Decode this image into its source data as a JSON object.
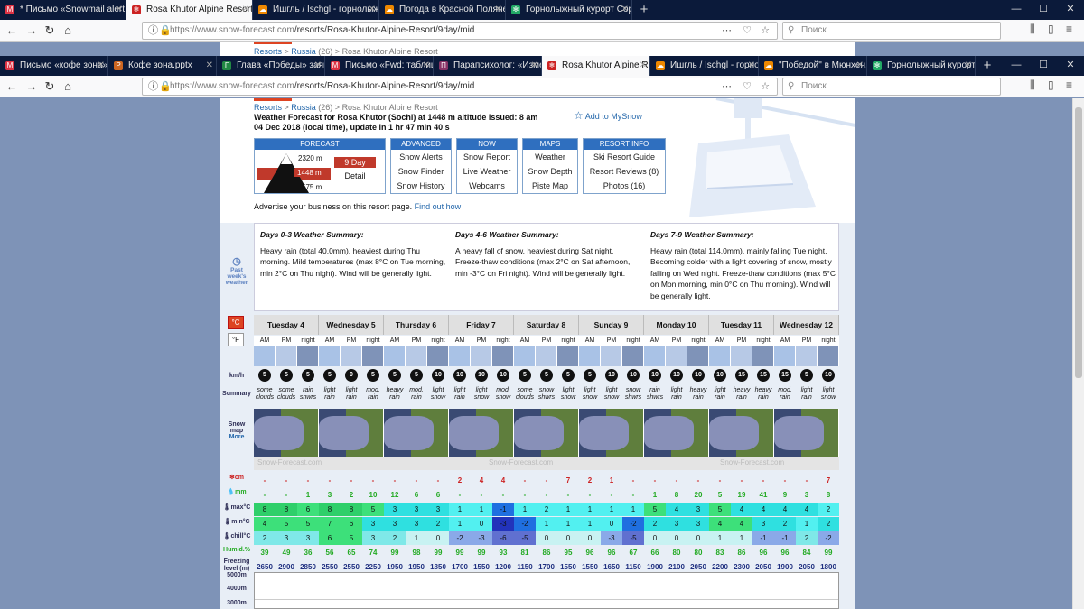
{
  "browser_back": {
    "tabs": [
      {
        "label": "* Письмо «Snowmail alert for R",
        "color": "#d34",
        "glyph": "M"
      },
      {
        "label": "Rosa Khutor Alpine Resort 9 Da",
        "color": "#c22",
        "glyph": "❄",
        "active": true
      },
      {
        "label": "Ишгль / Ischgl - горнолыжн",
        "color": "#e80",
        "glyph": "☁"
      },
      {
        "label": "Погода в Красной Поляне - С",
        "color": "#e80",
        "glyph": "☁"
      },
      {
        "label": "Горнолыжный курорт Сорон",
        "color": "#2a6",
        "glyph": "✻"
      }
    ],
    "url_domain": "https://www.snow-forecast.com",
    "url_path": "/resorts/Rosa-Khutor-Alpine-Resort/9day/mid",
    "search_placeholder": "Поиск"
  },
  "browser_front": {
    "tabs": [
      {
        "label": "Письмо «кофе зона»",
        "color": "#d34",
        "glyph": "M"
      },
      {
        "label": "Кофе зона.pptx",
        "color": "#c62",
        "glyph": "P"
      },
      {
        "label": "Глава «Победы» заявил",
        "color": "#284",
        "glyph": "Г"
      },
      {
        "label": "Письмо «Fwd: таблиц",
        "color": "#d34",
        "glyph": "M"
      },
      {
        "label": "Парапсихолог: «Измен",
        "color": "#836",
        "glyph": "П"
      },
      {
        "label": "Rosa Khutor Alpine Resor",
        "color": "#c22",
        "glyph": "❄",
        "active": true
      },
      {
        "label": "Ишгль / Ischgl - горнол",
        "color": "#e80",
        "glyph": "☁"
      },
      {
        "label": "\"Победой\" в Мюнхен. ",
        "color": "#e80",
        "glyph": "☁"
      },
      {
        "label": "Горнолыжный курорт С",
        "color": "#2a6",
        "glyph": "✻"
      }
    ],
    "url_domain": "https://www.snow-forecast.com",
    "url_path": "/resorts/Rosa-Khutor-Alpine-Resort/9day/mid",
    "search_placeholder": "Поиск"
  },
  "breadcrumb": {
    "resorts": "Resorts",
    "sep1": " > ",
    "country": "Russia",
    "count": " (26) > ",
    "resort": "Rosa Khutor Alpine Resort"
  },
  "forecast_info": {
    "line1": "Weather Forecast for Rosa Khutor (Sochi) at 1448 m altitude issued: 8 am",
    "line2": "04 Dec 2018 (local time), update in 1 hr 47 min 40 s"
  },
  "add_mysnow": "Add to MySnow",
  "menus": {
    "forecast": {
      "title": "FORECAST",
      "elev_top": "2320 m",
      "elev_mid": "1448 m",
      "elev_bot": "575 m",
      "nine_day": "9 Day",
      "detail": "Detail"
    },
    "advanced": {
      "title": "ADVANCED",
      "items": [
        "Snow Alerts",
        "Snow Finder",
        "Snow History"
      ]
    },
    "now": {
      "title": "NOW",
      "items": [
        "Snow Report",
        "Live Weather",
        "Webcams"
      ]
    },
    "maps": {
      "title": "MAPS",
      "items": [
        "Weather",
        "Snow Depth",
        "Piste Map"
      ]
    },
    "resort_info": {
      "title": "RESORT INFO",
      "items": [
        "Ski Resort Guide",
        "Resort Reviews (8)",
        "Photos (16)"
      ]
    }
  },
  "advert": {
    "text": "Advertise your business on this resort page. ",
    "link": "Find out how"
  },
  "summaries": [
    {
      "title": "Days 0-3 Weather Summary:",
      "text": "Heavy rain (total 40.0mm), heaviest during Thu morning. Mild temperatures (max 8°C on Tue morning, min 2°C on Thu night). Wind will be generally light."
    },
    {
      "title": "Days 4-6 Weather Summary:",
      "text": "A heavy fall of snow, heaviest during Sat night. Freeze-thaw conditions (max 2°C on Sat afternoon, min -3°C on Fri night). Wind will be generally light."
    },
    {
      "title": "Days 7-9 Weather Summary:",
      "text": "Heavy rain (total 114.0mm), mainly falling Tue night. Becoming colder with a light covering of snow, mostly falling on Wed night. Freeze-thaw conditions (max 5°C on Mon morning, min 0°C on Thu morning). Wind will be generally light."
    }
  ],
  "labels": {
    "past": "Past week's weather",
    "celsius": "°C",
    "fahrenheit": "°F",
    "kmh": "km/h",
    "summary": "Summary",
    "snowmap": "Snow map",
    "more": "More",
    "snow_cm": "cm",
    "rain_mm": "mm",
    "max": "max°C",
    "min": "min°C",
    "chill": "chill°C",
    "humid": "Humid.%",
    "freezing": "Freezing level (m)",
    "alt1": "5000m",
    "alt2": "4000m",
    "alt3": "3000m",
    "watermark": "Snow-Forecast.com"
  },
  "days": [
    "Tuesday 4",
    "Wednesday 5",
    "Thursday 6",
    "Friday 7",
    "Saturday 8",
    "Sunday 9",
    "Monday 10",
    "Tuesday 11",
    "Wednesday 12"
  ],
  "periods": [
    "AM",
    "PM",
    "night"
  ],
  "wind": [
    "5",
    "5",
    "5",
    "5",
    "0",
    "5",
    "5",
    "5",
    "10",
    "10",
    "10",
    "10",
    "5",
    "5",
    "5",
    "5",
    "10",
    "10",
    "10",
    "10",
    "10",
    "10",
    "15",
    "15",
    "15",
    "5",
    "10"
  ],
  "summary_text": [
    "some clouds",
    "some clouds",
    "rain shwrs",
    "light rain",
    "light rain",
    "mod. rain",
    "heavy rain",
    "mod. rain",
    "light snow",
    "light rain",
    "light snow",
    "mod. snow",
    "some clouds",
    "snow shwrs",
    "light snow",
    "light snow",
    "light snow",
    "snow shwrs",
    "rain shwrs",
    "light rain",
    "heavy rain",
    "light rain",
    "heavy rain",
    "heavy rain",
    "mod. rain",
    "light rain",
    "light snow"
  ],
  "snow_cm": [
    "-",
    "-",
    "-",
    "-",
    "-",
    "-",
    "-",
    "-",
    "-",
    "2",
    "4",
    "4",
    "-",
    "-",
    "7",
    "2",
    "1",
    "-",
    "-",
    "-",
    "-",
    "-",
    "-",
    "-",
    "-",
    "-",
    "7"
  ],
  "rain_mm": [
    "-",
    "-",
    "1",
    "3",
    "2",
    "10",
    "12",
    "6",
    "6",
    "-",
    "-",
    "-",
    "-",
    "-",
    "-",
    "-",
    "-",
    "-",
    "1",
    "8",
    "20",
    "5",
    "19",
    "41",
    "9",
    "3",
    "8"
  ],
  "max_c": [
    "8",
    "8",
    "6",
    "8",
    "8",
    "5",
    "3",
    "3",
    "3",
    "1",
    "1",
    "-1",
    "1",
    "2",
    "1",
    "1",
    "1",
    "1",
    "5",
    "4",
    "3",
    "5",
    "4",
    "4",
    "4",
    "4",
    "2"
  ],
  "min_c": [
    "4",
    "5",
    "5",
    "7",
    "6",
    "3",
    "3",
    "3",
    "2",
    "1",
    "0",
    "-3",
    "-2",
    "1",
    "1",
    "1",
    "0",
    "-2",
    "2",
    "3",
    "3",
    "4",
    "4",
    "3",
    "2",
    "1",
    "2"
  ],
  "chill_c": [
    "2",
    "3",
    "3",
    "6",
    "5",
    "3",
    "2",
    "1",
    "0",
    "-2",
    "-3",
    "-6",
    "-5",
    "0",
    "0",
    "0",
    "-3",
    "-5",
    "0",
    "0",
    "0",
    "1",
    "1",
    "-1",
    "-1",
    "2",
    "-2"
  ],
  "humidity": [
    "39",
    "49",
    "36",
    "56",
    "65",
    "74",
    "99",
    "98",
    "99",
    "99",
    "99",
    "93",
    "81",
    "86",
    "95",
    "96",
    "96",
    "67",
    "66",
    "80",
    "80",
    "83",
    "86",
    "96",
    "96",
    "84",
    "99"
  ],
  "freezing": [
    "2650",
    "2900",
    "2850",
    "2550",
    "2550",
    "2250",
    "1950",
    "1950",
    "1850",
    "1700",
    "1550",
    "1200",
    "1150",
    "1700",
    "1550",
    "1550",
    "1650",
    "1150",
    "1900",
    "2100",
    "2050",
    "2200",
    "2300",
    "2050",
    "1900",
    "2050",
    "1800"
  ],
  "colors": {
    "accent_red": "#c0392b",
    "link_blue": "#2266aa",
    "menu_head": "#2f6fbf"
  }
}
